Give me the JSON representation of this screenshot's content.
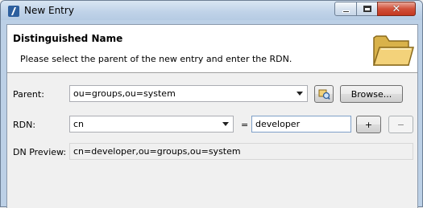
{
  "window": {
    "title": "New Entry"
  },
  "header": {
    "title": "Distinguished Name",
    "description": "Please select the parent of the new entry and enter the RDN."
  },
  "form": {
    "parent_label": "Parent:",
    "parent_value": "ou=groups,ou=system",
    "browse_label": "Browse...",
    "rdn_label": "RDN:",
    "rdn_attribute": "cn",
    "equals": "=",
    "rdn_value": "developer",
    "add_label": "+",
    "remove_label": "−",
    "preview_label": "DN Preview:",
    "preview_value": "cn=developer,ou=groups,ou=system"
  }
}
